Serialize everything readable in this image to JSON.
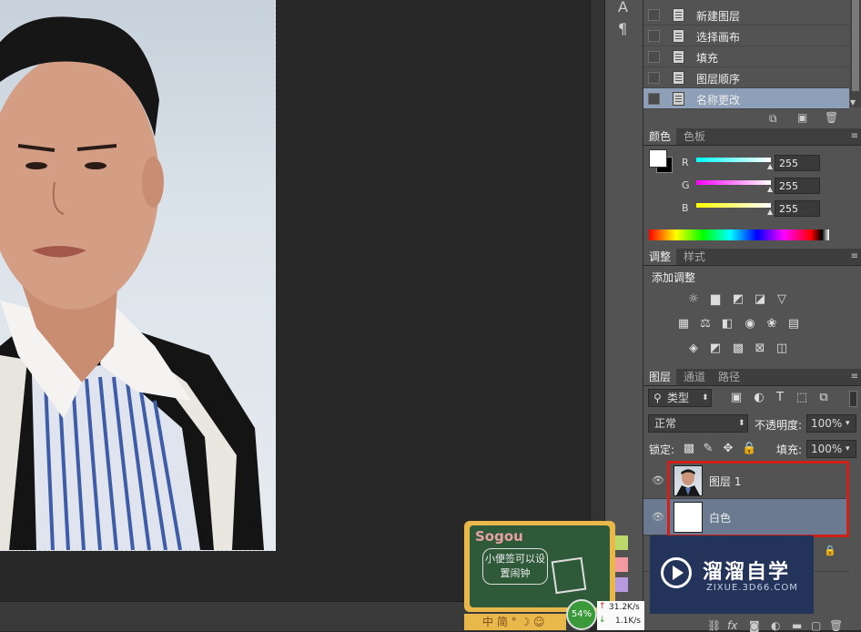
{
  "history": {
    "items": [
      {
        "label": "新建图层",
        "selected": false
      },
      {
        "label": "选择画布",
        "selected": false
      },
      {
        "label": "填充",
        "selected": false
      },
      {
        "label": "图层顺序",
        "selected": false
      },
      {
        "label": "名称更改",
        "selected": true
      }
    ]
  },
  "color_panel": {
    "tab_color": "颜色",
    "tab_swatches": "色板",
    "r_label": "R",
    "r_value": "255",
    "g_label": "G",
    "g_value": "255",
    "b_label": "B",
    "b_value": "255"
  },
  "adjust_panel": {
    "tab_adjust": "调整",
    "tab_styles": "样式",
    "add_label": "添加调整"
  },
  "layers_panel": {
    "tab_layers": "图层",
    "tab_channels": "通道",
    "tab_paths": "路径",
    "filter_kind": "类型",
    "blend_mode": "正常",
    "opacity_label": "不透明度:",
    "opacity_value": "100%",
    "lock_label": "锁定:",
    "fill_label": "填充:",
    "fill_value": "100%",
    "layers": [
      {
        "name": "图层 1"
      },
      {
        "name": "白色"
      }
    ]
  },
  "sogou_widget": {
    "logo": "Sogou",
    "note": "小便签可以设置闹钟",
    "bar": "中 简 ° ☽ ☺",
    "net_percent": "54%",
    "up_speed": "31.2K/s",
    "down_speed": "1.1K/s"
  },
  "watermark": {
    "title": "溜溜自学",
    "url": "ZIXUE.3D66.COM"
  },
  "colors": {
    "accent_red": "#d0201a",
    "selection": "#8e9fb8",
    "panel": "#535353"
  }
}
